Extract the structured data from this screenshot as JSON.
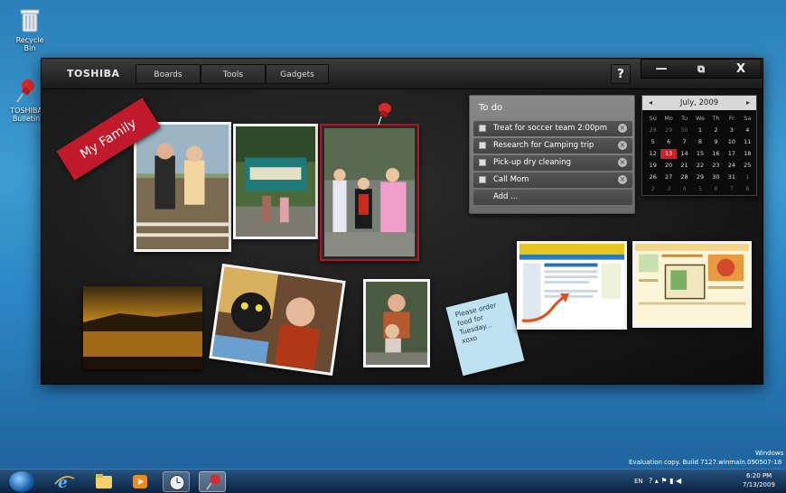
{
  "desktop": {
    "icons": [
      {
        "label": "Recycle Bin",
        "icon": "recycle-bin-icon"
      },
      {
        "label": "TOSHIBA Bulletin",
        "icon": "pushpin-icon"
      }
    ],
    "watermark": {
      "line1": "Windows",
      "line2": "Evaluation copy. Build 7127.winmain.090507-18"
    }
  },
  "window": {
    "brand": "TOSHIBA",
    "menu": [
      "Boards",
      "Tools",
      "Gadgets"
    ],
    "help_label": "?",
    "controls": {
      "minimize": "—",
      "restore": "⧉",
      "close": "X"
    }
  },
  "board": {
    "title_tag": "My Family",
    "sticky_note": "Please order food for Tuesday... xoxo"
  },
  "todo": {
    "title": "To do",
    "items": [
      "Treat for soccer team 2:00pm",
      "Research for Camping trip",
      "Pick-up dry cleaning",
      "Call Mom"
    ],
    "add_label": "Add ..."
  },
  "calendar": {
    "month_label": "July, 2009",
    "prev": "◂",
    "next": "▸",
    "weekdays": [
      "Su",
      "Mo",
      "Tu",
      "We",
      "Th",
      "Fr",
      "Sa"
    ],
    "weeks": [
      [
        "28",
        "29",
        "30",
        "1",
        "2",
        "3",
        "4"
      ],
      [
        "5",
        "6",
        "7",
        "8",
        "9",
        "10",
        "11"
      ],
      [
        "12",
        "13",
        "14",
        "15",
        "16",
        "17",
        "18"
      ],
      [
        "19",
        "20",
        "21",
        "22",
        "23",
        "24",
        "25"
      ],
      [
        "26",
        "27",
        "28",
        "29",
        "30",
        "31",
        "1"
      ],
      [
        "2",
        "3",
        "4",
        "5",
        "6",
        "7",
        "8"
      ]
    ],
    "today": "13"
  },
  "taskbar": {
    "language": "EN",
    "time": "6:20 PM",
    "date": "7/13/2009"
  },
  "colors": {
    "accent_red": "#c9202e",
    "desktop_blue": "#2d86c4",
    "board_dark": "#151515"
  }
}
